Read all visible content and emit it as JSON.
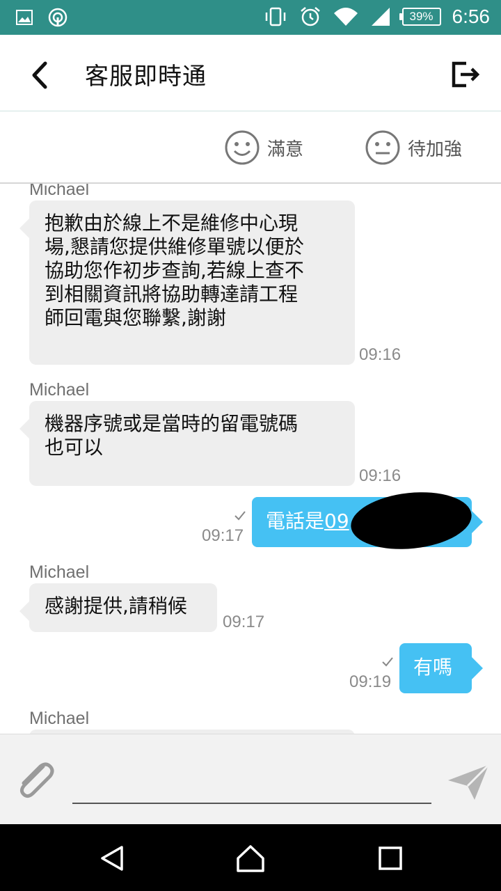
{
  "status_bar": {
    "battery": "39%",
    "time": "6:56",
    "icons": [
      "gallery-icon",
      "cast-icon",
      "vibrate-icon",
      "alarm-icon",
      "wifi-icon",
      "signal-icon",
      "battery-icon"
    ]
  },
  "header": {
    "title": "客服即時通",
    "back_icon": "chevron-left-icon",
    "exit_icon": "exit-icon"
  },
  "rating": {
    "satisfied_label": "滿意",
    "improve_label": "待加強"
  },
  "messages": [
    {
      "sender": "Michael",
      "text_lines": [
        "抱歉由於線上不是維修中心現",
        "場,懇請您提供維修單號以便於",
        "協助您作初步查詢,若線上查不",
        "到相關資訊將協助轉達請工程",
        "師回電與您聯繫,謝謝"
      ],
      "time": "09:16"
    },
    {
      "sender": "Michael",
      "text_lines": [
        "機器序號或是當時的留電號碼",
        "也可以"
      ],
      "time": "09:16"
    },
    {
      "outgoing": true,
      "text": "電話是",
      "text_link": "09",
      "time": "09:17"
    },
    {
      "sender": "Michael",
      "text": "感謝提供,請稍候",
      "time": "09:17"
    },
    {
      "outgoing": true,
      "text": "有嗎",
      "time": "09:19"
    },
    {
      "sender": "Michael"
    }
  ],
  "input": {
    "value": "",
    "placeholder": ""
  },
  "colors": {
    "status_bar": "#2f8f88",
    "outgoing_bubble": "#45c1f3",
    "incoming_bubble": "#eeeeee"
  }
}
